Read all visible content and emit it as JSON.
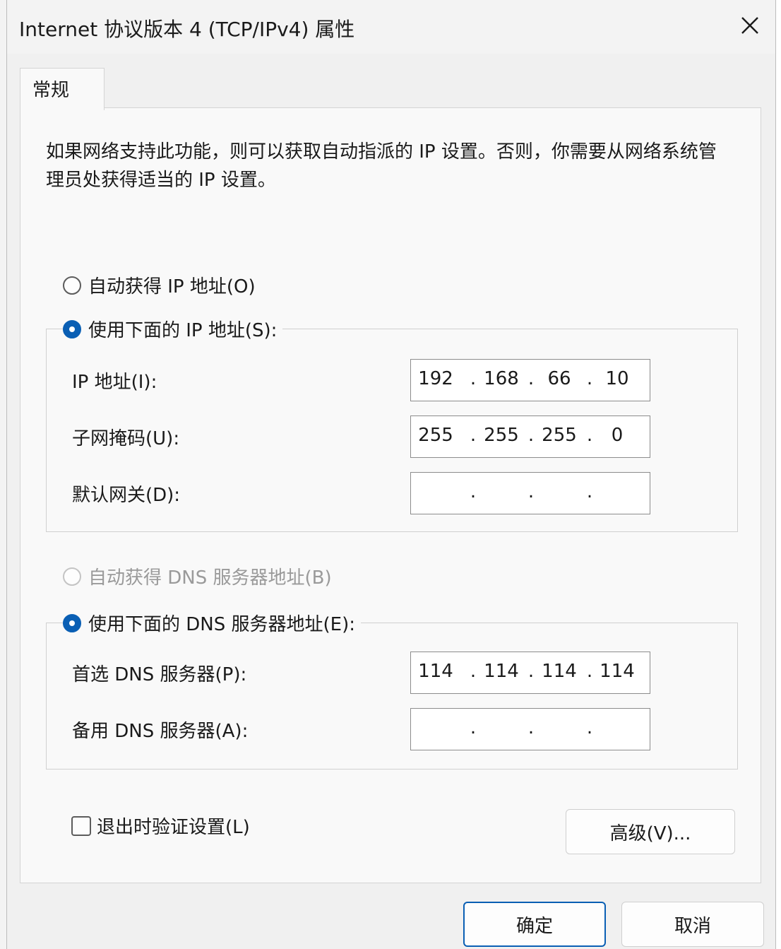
{
  "window": {
    "title": "Internet 协议版本 4 (TCP/IPv4) 属性",
    "close_glyph": "✕"
  },
  "tabs": [
    {
      "label": "常规",
      "selected": true
    }
  ],
  "description": "如果网络支持此功能，则可以获取自动指派的 IP 设置。否则，你需要从网络系统管理员处获得适当的 IP 设置。",
  "ip_settings": {
    "auto_label": "自动获得 IP 地址(O)",
    "auto_selected": false,
    "manual_label": "使用下面的 IP 地址(S):",
    "manual_selected": true,
    "ip_address": {
      "label": "IP 地址(I):",
      "octets": [
        "192",
        "168",
        "66",
        "10"
      ]
    },
    "subnet_mask": {
      "label": "子网掩码(U):",
      "octets": [
        "255",
        "255",
        "255",
        "0"
      ]
    },
    "default_gateway": {
      "label": "默认网关(D):",
      "octets": [
        "",
        "",
        "",
        ""
      ]
    }
  },
  "dns_settings": {
    "auto_label": "自动获得 DNS 服务器地址(B)",
    "auto_enabled": false,
    "manual_label": "使用下面的 DNS 服务器地址(E):",
    "manual_selected": true,
    "preferred": {
      "label": "首选 DNS 服务器(P):",
      "octets": [
        "114",
        "114",
        "114",
        "114"
      ]
    },
    "alternate": {
      "label": "备用 DNS 服务器(A):",
      "octets": [
        "",
        "",
        "",
        ""
      ]
    }
  },
  "validate_on_exit": {
    "label": "退出时验证设置(L)",
    "checked": false
  },
  "buttons": {
    "advanced": "高级(V)...",
    "ok": "确定",
    "cancel": "取消"
  },
  "colors": {
    "accent": "#0a5fb4",
    "dialog_bg": "#f0f0f0",
    "panel_bg": "#f9f9f9"
  }
}
